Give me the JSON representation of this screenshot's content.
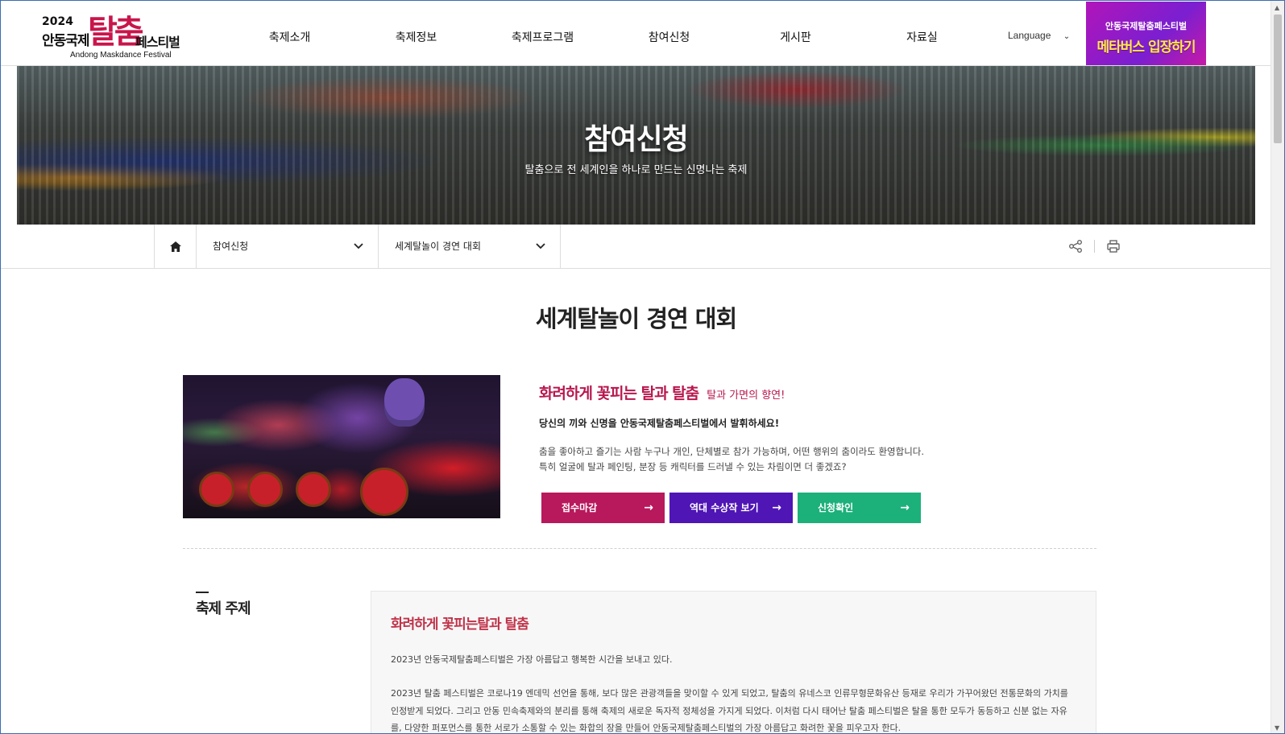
{
  "header": {
    "logo": {
      "year": "2024",
      "andong": "안동국제",
      "tal": "탈춤",
      "festival": "페스티벌",
      "english": "Andong Maskdance Festival"
    },
    "menu": [
      {
        "label": "축제소개"
      },
      {
        "label": "축제정보"
      },
      {
        "label": "축제프로그램"
      },
      {
        "label": "참여신청"
      },
      {
        "label": "게시판"
      },
      {
        "label": "자료실"
      }
    ],
    "language_label": "Language",
    "metaverse_banner": {
      "line1": "안동국제탈춤페스티벌",
      "line2": "메타버스 입장하기"
    }
  },
  "hero": {
    "title": "참여신청",
    "subtitle": "탈춤으로 전 세계인을 하나로 만드는 신명나는 축제"
  },
  "location": {
    "depth1": "참여신청",
    "depth2": "세계탈놀이 경연 대회"
  },
  "page": {
    "title": "세계탈놀이 경연 대회"
  },
  "intro": {
    "heading": "화려하게 꽃피는 탈과 탈춤",
    "heading_sub": "탈과 가면의 향연!",
    "lead": "당신의 끼와 신명을 안동국제탈춤페스티벌에서 발휘하세요!",
    "desc_line1": "춤을 좋아하고 즐기는 사람 누구나 개인, 단체별로 참가 가능하며, 어떤 행위의 춤이라도 환영합니다.",
    "desc_line2": "특히 얼굴에 탈과 페인팅, 분장 등 캐릭터를 드러낼 수 있는 차림이면 더 좋겠죠?",
    "buttons": [
      {
        "label": "접수마감",
        "color": "#b8185c"
      },
      {
        "label": "역대 수상작 보기",
        "color": "#4f15b5"
      },
      {
        "label": "신청확인",
        "color": "#1cb07b"
      }
    ]
  },
  "theme": {
    "section_title": "축제 주제",
    "heading": "화려하게 꽃피는탈과 탈춤",
    "para1": "2023년 안동국제탈춤페스티벌은 가장 아름답고 행복한 시간을 보내고 있다.",
    "para2": "2023년 탈춤 페스티벌은 코로나19 엔데믹 선언을 통해, 보다 많은 관광객들을 맞이할 수 있게 되었고, 탈춤의 유네스코 인류무형문화유산 등재로 우리가 가꾸어왔던 전통문화의 가치를 인정받게 되었다. 그리고 안동 민속축제와의 분리를 통해 축제의 새로운 독자적 정체성을 가지게 되었다. 이처럼 다시 태어난 탈춤 페스티벌은 탈을 통한 모두가 동등하고 신분 없는 자유를, 다양한 퍼포먼스를 통한 서로가 소통할 수 있는 화합의 장을 만들어 안동국제탈춤페스티벌의 가장 아름답고 화려한 꽃을 피우고자 한다."
  },
  "colors": {
    "brand_pink": "#b8184f",
    "theme_red": "#c0334a"
  }
}
